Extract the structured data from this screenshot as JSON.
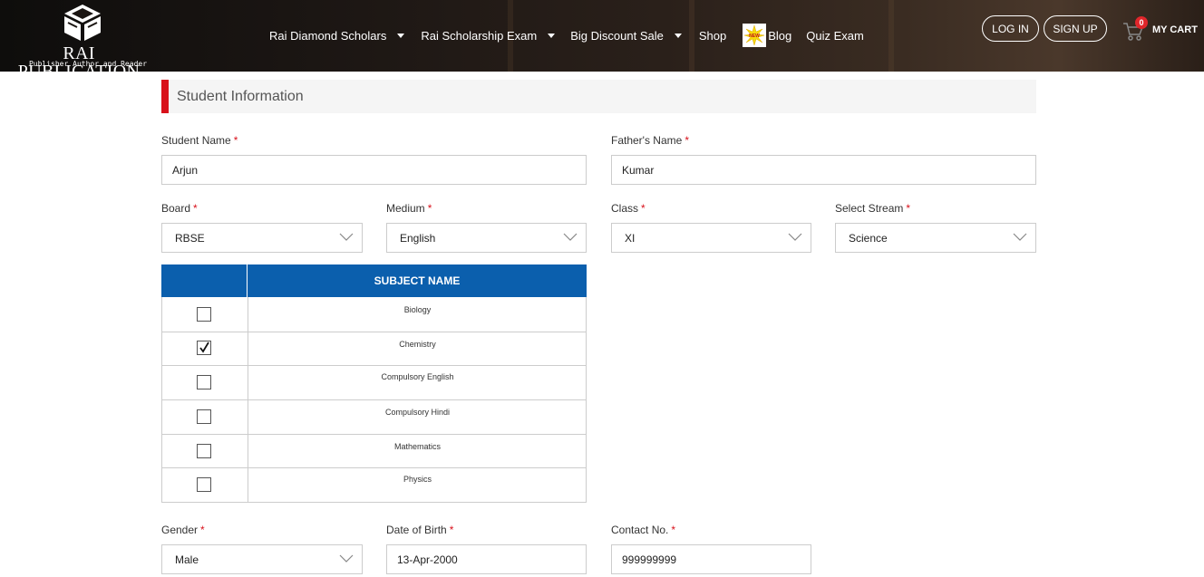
{
  "header": {
    "logo": {
      "title": "RAI PUBLICATION",
      "subtitle": "Publisher Author and Reader"
    },
    "nav": [
      {
        "label": "Rai Diamond Scholars",
        "dropdown": true
      },
      {
        "label": "Rai Scholarship Exam",
        "dropdown": true
      },
      {
        "label": "Big Discount Sale",
        "dropdown": true
      },
      {
        "label": "Shop",
        "dropdown": false
      },
      {
        "label": "Blog",
        "dropdown": false,
        "badge": "NEW"
      },
      {
        "label": "Quiz Exam",
        "dropdown": false
      }
    ],
    "login_label": "LOG IN",
    "signup_label": "SIGN UP",
    "cart": {
      "count": "0",
      "label": "MY CART"
    }
  },
  "section": {
    "title": "Student Information"
  },
  "form": {
    "student_name": {
      "label": "Student Name",
      "value": "Arjun"
    },
    "father_name": {
      "label": "Father's Name",
      "value": "Kumar"
    },
    "board": {
      "label": "Board",
      "value": "RBSE"
    },
    "medium": {
      "label": "Medium",
      "value": "English"
    },
    "class": {
      "label": "Class",
      "value": "XI"
    },
    "stream": {
      "label": "Select Stream",
      "value": "Science"
    },
    "gender": {
      "label": "Gender",
      "value": "Male"
    },
    "dob": {
      "label": "Date of Birth",
      "value": "13-Apr-2000"
    },
    "contact": {
      "label": "Contact No.",
      "value": "999999999"
    },
    "required_mark": "*"
  },
  "subjects": {
    "header": "SUBJECT NAME",
    "rows": [
      {
        "name": "Biology",
        "checked": false
      },
      {
        "name": "Chemistry",
        "checked": true
      },
      {
        "name": "Compulsory English",
        "checked": false
      },
      {
        "name": "Compulsory Hindi",
        "checked": false
      },
      {
        "name": "Mathematics",
        "checked": false
      },
      {
        "name": "Physics",
        "checked": false
      }
    ]
  },
  "colors": {
    "accent_red": "#d8111b",
    "table_header_blue": "#0b5fad",
    "badge_red": "#e0262b"
  }
}
